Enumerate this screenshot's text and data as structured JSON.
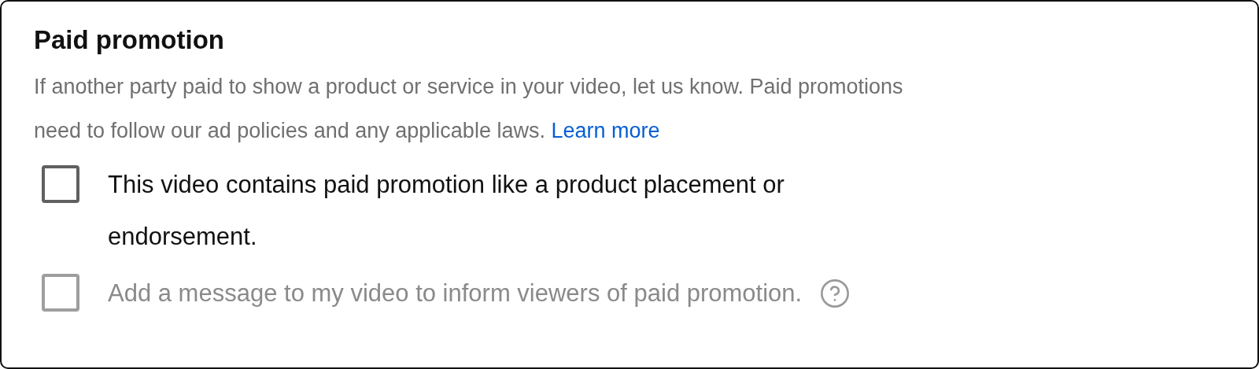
{
  "section": {
    "title": "Paid promotion",
    "description": "If another party paid to show a product or service in your video, let us know. Paid promotions need to follow our ad policies and any applicable laws.",
    "link": "Learn more"
  },
  "options": [
    {
      "label": "This video contains paid promotion like a product placement or endorsement.",
      "checked": false,
      "disabled": false,
      "help": false
    },
    {
      "label": "Add a message to my video to inform viewers of paid promotion.",
      "checked": false,
      "disabled": true,
      "help": true
    }
  ]
}
